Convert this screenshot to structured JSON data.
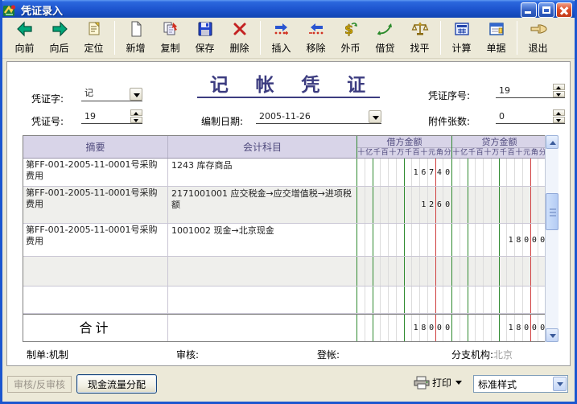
{
  "window": {
    "title": "凭证录入"
  },
  "toolbar": {
    "groups": [
      [
        {
          "name": "prev",
          "icon": "arrow-left",
          "label": "向前"
        },
        {
          "name": "next",
          "icon": "arrow-right",
          "label": "向后"
        },
        {
          "name": "locate",
          "icon": "locate",
          "label": "定位"
        }
      ],
      [
        {
          "name": "new",
          "icon": "new-page",
          "label": "新增"
        },
        {
          "name": "copy",
          "icon": "copy",
          "label": "复制"
        },
        {
          "name": "save",
          "icon": "save",
          "label": "保存"
        },
        {
          "name": "delete",
          "icon": "delete",
          "label": "删除"
        }
      ],
      [
        {
          "name": "insert",
          "icon": "insert-row",
          "label": "插入"
        },
        {
          "name": "remove",
          "icon": "remove-row",
          "label": "移除"
        },
        {
          "name": "foreign-currency",
          "icon": "currency",
          "label": "外币"
        },
        {
          "name": "debit-credit",
          "icon": "debit-credit",
          "label": "借贷"
        },
        {
          "name": "balance",
          "icon": "balance",
          "label": "找平"
        }
      ],
      [
        {
          "name": "calculate",
          "icon": "calculator",
          "label": "计算"
        },
        {
          "name": "document",
          "icon": "document",
          "label": "单据"
        }
      ],
      [
        {
          "name": "exit",
          "icon": "exit-hand",
          "label": "退出"
        }
      ]
    ]
  },
  "form": {
    "title": "记 帐 凭 证",
    "voucher_word": {
      "label": "凭证字:",
      "value": "记"
    },
    "voucher_no": {
      "label": "凭证号:",
      "value": "19"
    },
    "date": {
      "label": "编制日期:",
      "value": "2005-11-26"
    },
    "sequence": {
      "label": "凭证序号:",
      "value": "19"
    },
    "attachments": {
      "label": "附件张数:",
      "value": "0"
    }
  },
  "grid": {
    "headers": {
      "summary": "摘要",
      "account": "会计科目",
      "debit": "借方金额",
      "credit": "贷方金额"
    },
    "digit_columns": [
      "十",
      "亿",
      "千",
      "百",
      "十",
      "万",
      "千",
      "百",
      "十",
      "元",
      "角",
      "分"
    ],
    "rows": [
      {
        "summary": "第FF-001-2005-11-0001号采购费用",
        "account": "1243 库存商品",
        "debit": "167.40",
        "credit": ""
      },
      {
        "summary": "第FF-001-2005-11-0001号采购费用",
        "account": "2171001001 应交税金→应交增值税→进项税额",
        "debit": "12.60",
        "credit": ""
      },
      {
        "summary": "第FF-001-2005-11-0001号采购费用",
        "account": "1001002 现金→北京现金",
        "debit": "",
        "credit": "180.00"
      },
      {
        "summary": "",
        "account": "",
        "debit": "",
        "credit": ""
      },
      {
        "summary": "",
        "account": "",
        "debit": "",
        "credit": ""
      }
    ],
    "total": {
      "label": "合计",
      "debit": "180.00",
      "credit": "180.00"
    }
  },
  "footer": {
    "prepared": {
      "label": "制单:",
      "value": "机制"
    },
    "audited": {
      "label": "审核:",
      "value": ""
    },
    "posted": {
      "label": "登帐:",
      "value": ""
    },
    "branch": {
      "label": "分支机构:",
      "value": "北京"
    }
  },
  "bottom_bar": {
    "audit_button": "审核/反审核",
    "cashflow_button": "现金流量分配",
    "print_label": "打印",
    "style_select": "标准样式"
  }
}
